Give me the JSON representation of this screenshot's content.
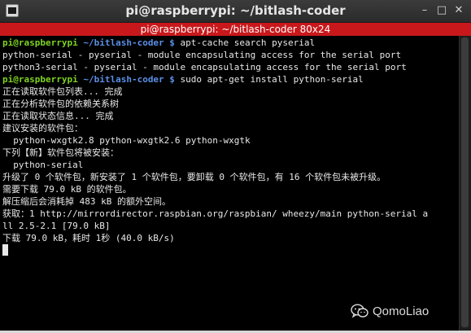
{
  "window": {
    "title": "pi@raspberrypi: ~/bitlash-coder",
    "minimize_label": "–",
    "maximize_label": "□",
    "close_label": "✕",
    "icon": "terminal-icon"
  },
  "tab": {
    "label": "pi@raspberrypi: ~/bitlash-coder 80x24"
  },
  "terminal": {
    "lines": [
      {
        "user": "pi@raspberrypi",
        "path": "~/bitlash-coder $",
        "cmd": " apt-cache search pyserial"
      },
      {
        "text": "python-serial - pyserial - module encapsulating access for the serial port"
      },
      {
        "text": "python3-serial - pyserial - module encapsulating access for the serial port"
      },
      {
        "user": "pi@raspberrypi",
        "path": "~/bitlash-coder $",
        "cmd": " sudo apt-get install python-serial"
      },
      {
        "text": "正在读取软件包列表... 完成"
      },
      {
        "text": "正在分析软件包的依赖关系树"
      },
      {
        "text": "正在读取状态信息... 完成"
      },
      {
        "text": "建议安装的软件包："
      },
      {
        "text": "  python-wxgtk2.8 python-wxgtk2.6 python-wxgtk"
      },
      {
        "text": "下列【新】软件包将被安装："
      },
      {
        "text": "  python-serial"
      },
      {
        "text": "升级了 0 个软件包，新安装了 1 个软件包，要卸载 0 个软件包，有 16 个软件包未被升级。"
      },
      {
        "text": "需要下载 79.0 kB 的软件包。"
      },
      {
        "text": "解压缩后会消耗掉 483 kB 的额外空间。"
      },
      {
        "text": "获取：1 http://mirrordirector.raspbian.org/raspbian/ wheezy/main python-serial a"
      },
      {
        "text": "ll 2.5-2.1 [79.0 kB]"
      },
      {
        "text": "下载 79.0 kB，耗时 1秒 (40.0 kB/s)"
      }
    ]
  },
  "watermark": {
    "text": "QomoLiao",
    "icon": "wechat-icon"
  }
}
